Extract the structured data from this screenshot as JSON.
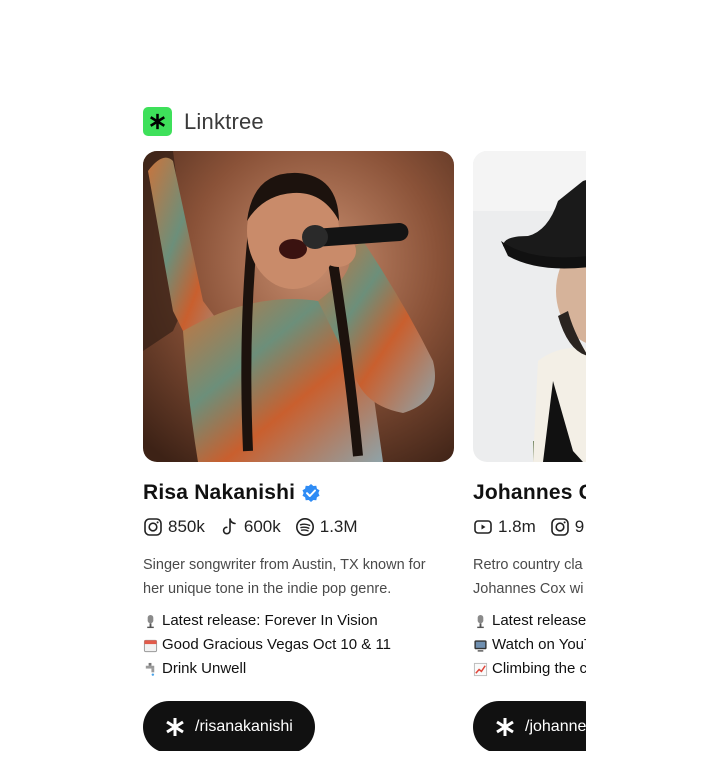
{
  "brand": {
    "name": "Linktree",
    "logo_icon": "linktree-star-icon",
    "logo_color": "#3ee05a"
  },
  "cards": [
    {
      "name": "Risa Nakanishi",
      "verified": true,
      "stats": [
        {
          "icon": "instagram-icon",
          "value": "850k"
        },
        {
          "icon": "tiktok-icon",
          "value": "600k"
        },
        {
          "icon": "spotify-icon",
          "value": "1.3M"
        }
      ],
      "bio": [
        "Singer songwriter from Austin, TX known for",
        "her unique tone in the indie pop genre."
      ],
      "links": [
        {
          "icon": "microphone-icon",
          "text": "Latest release: Forever In Vision"
        },
        {
          "icon": "calendar-icon",
          "text": "Good Gracious Vegas Oct 10 & 11"
        },
        {
          "icon": "faucet-icon",
          "text": "Drink Unwell"
        }
      ],
      "handle": "/risanakanishi"
    },
    {
      "name": "Johannes C",
      "verified": false,
      "stats": [
        {
          "icon": "youtube-icon",
          "value": "1.8m"
        },
        {
          "icon": "instagram-icon",
          "value": "9"
        }
      ],
      "bio": [
        "Retro country cla",
        "Johannes Cox wi"
      ],
      "links": [
        {
          "icon": "microphone-icon",
          "text": "Latest release"
        },
        {
          "icon": "television-icon",
          "text": "Watch on YouT"
        },
        {
          "icon": "chart-up-icon",
          "text": "Climbing the c"
        }
      ],
      "handle": "/johanne"
    }
  ]
}
